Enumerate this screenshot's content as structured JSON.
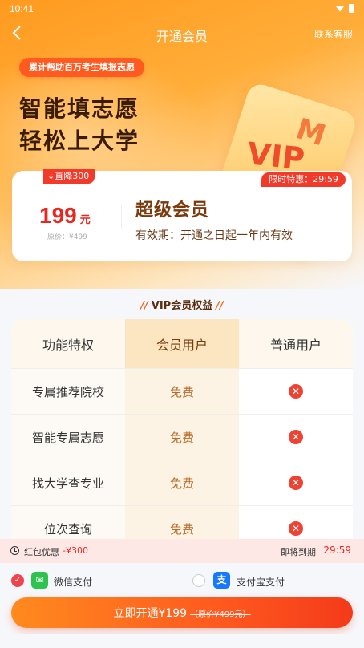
{
  "status_bar": {
    "time": "10:41"
  },
  "nav": {
    "title": "开通会员",
    "service": "联系客服"
  },
  "hero": {
    "pill": "累计帮助百万考生填报志愿",
    "slogan_line1": "智能填志愿",
    "slogan_line2": "轻松上大学",
    "card_text": "VIP"
  },
  "price_card": {
    "drop_badge": "直降300",
    "time_badge": "限时特惠：29:59",
    "price": "199",
    "price_unit": "元",
    "original_price": "原价：¥499",
    "plan_name": "超级会员",
    "validity": "有效期：开通之日起一年内有效"
  },
  "section_title": "VIP会员权益",
  "table": {
    "headers": [
      "功能特权",
      "会员用户",
      "普通用户"
    ],
    "rows": [
      {
        "feature": "专属推荐院校",
        "vip": "免费"
      },
      {
        "feature": "智能专属志愿",
        "vip": "免费"
      },
      {
        "feature": "找大学查专业",
        "vip": "免费"
      },
      {
        "feature": "位次查询",
        "vip": "免费"
      }
    ]
  },
  "coupon": {
    "label": "红包优惠",
    "amount": "-¥300",
    "expire_label": "即将到期",
    "expire_time": "29:59"
  },
  "payment": {
    "wechat": "微信支付",
    "alipay": "支付宝支付",
    "selected": "wechat"
  },
  "buy_button": {
    "label": "立即开通¥199",
    "original": "（原价¥499元）"
  },
  "colors": {
    "accent_red": "#e8281f",
    "accent_orange": "#ff8a1e",
    "wechat_green": "#2ec24e",
    "alipay_blue": "#1677ff"
  }
}
